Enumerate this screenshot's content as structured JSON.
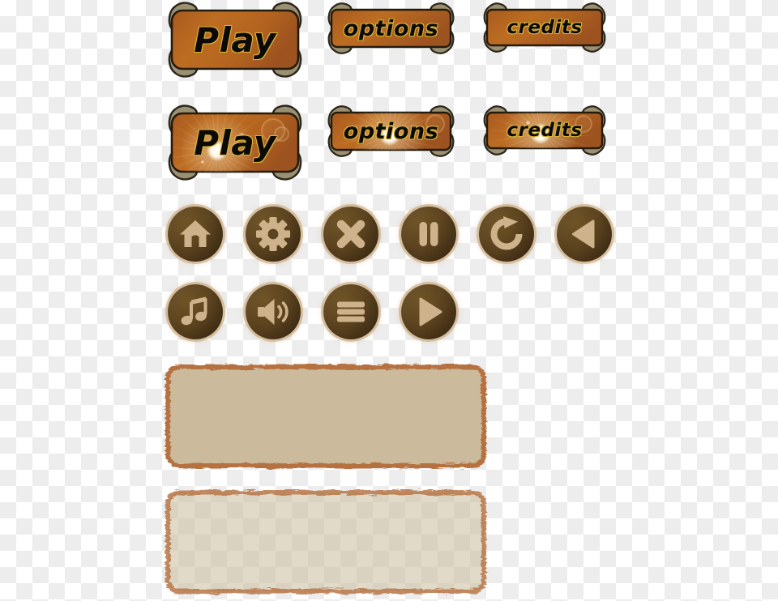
{
  "sheet": {
    "title": "Game UI Asset Sheet",
    "background": "transparent-checkerboard"
  },
  "palette": {
    "plaque_fill_light": "#c2701f",
    "plaque_fill_dark": "#9e5520",
    "plaque_outline": "#231a0c",
    "bone_fill": "#9a9173",
    "bone_outline": "#2c2519",
    "label_fill": "#0b0a06",
    "label_outline": "#d9b43a",
    "disc_fill": "#5d4420",
    "disc_rim": "#ceb28b",
    "icon_fill": "#ceb28b",
    "panel_border": "#b5713f",
    "panel_fill_solid": "#cbbb9c",
    "panel_fill_translucent": "#cbbb9c",
    "checker_light": "#ffffff",
    "checker_dark": "#ededed"
  },
  "plaque_buttons": [
    {
      "id": "play-normal",
      "label": "Play",
      "state": "normal",
      "size": "large"
    },
    {
      "id": "options-normal",
      "label": "options",
      "state": "normal",
      "size": "small"
    },
    {
      "id": "credits-normal",
      "label": "credits",
      "state": "normal",
      "size": "small"
    },
    {
      "id": "play-highlight",
      "label": "Play",
      "state": "highlight",
      "size": "large"
    },
    {
      "id": "options-highlight",
      "label": "options",
      "state": "highlight",
      "size": "small"
    },
    {
      "id": "credits-highlight",
      "label": "credits",
      "state": "highlight",
      "size": "small"
    }
  ],
  "icon_buttons_row1": [
    {
      "id": "home",
      "icon": "home-icon"
    },
    {
      "id": "settings",
      "icon": "gear-icon"
    },
    {
      "id": "close",
      "icon": "close-icon"
    },
    {
      "id": "pause",
      "icon": "pause-icon"
    },
    {
      "id": "restart",
      "icon": "restart-icon"
    },
    {
      "id": "back",
      "icon": "previous-icon"
    }
  ],
  "icon_buttons_row2": [
    {
      "id": "music",
      "icon": "music-note-icon"
    },
    {
      "id": "sound",
      "icon": "speaker-icon"
    },
    {
      "id": "menu",
      "icon": "hamburger-menu-icon"
    },
    {
      "id": "play",
      "icon": "play-icon"
    }
  ],
  "panels": [
    {
      "id": "panel-solid",
      "fill": "solid",
      "opacity": 1
    },
    {
      "id": "panel-translucent",
      "fill": "translucent",
      "opacity": 0.55
    }
  ]
}
